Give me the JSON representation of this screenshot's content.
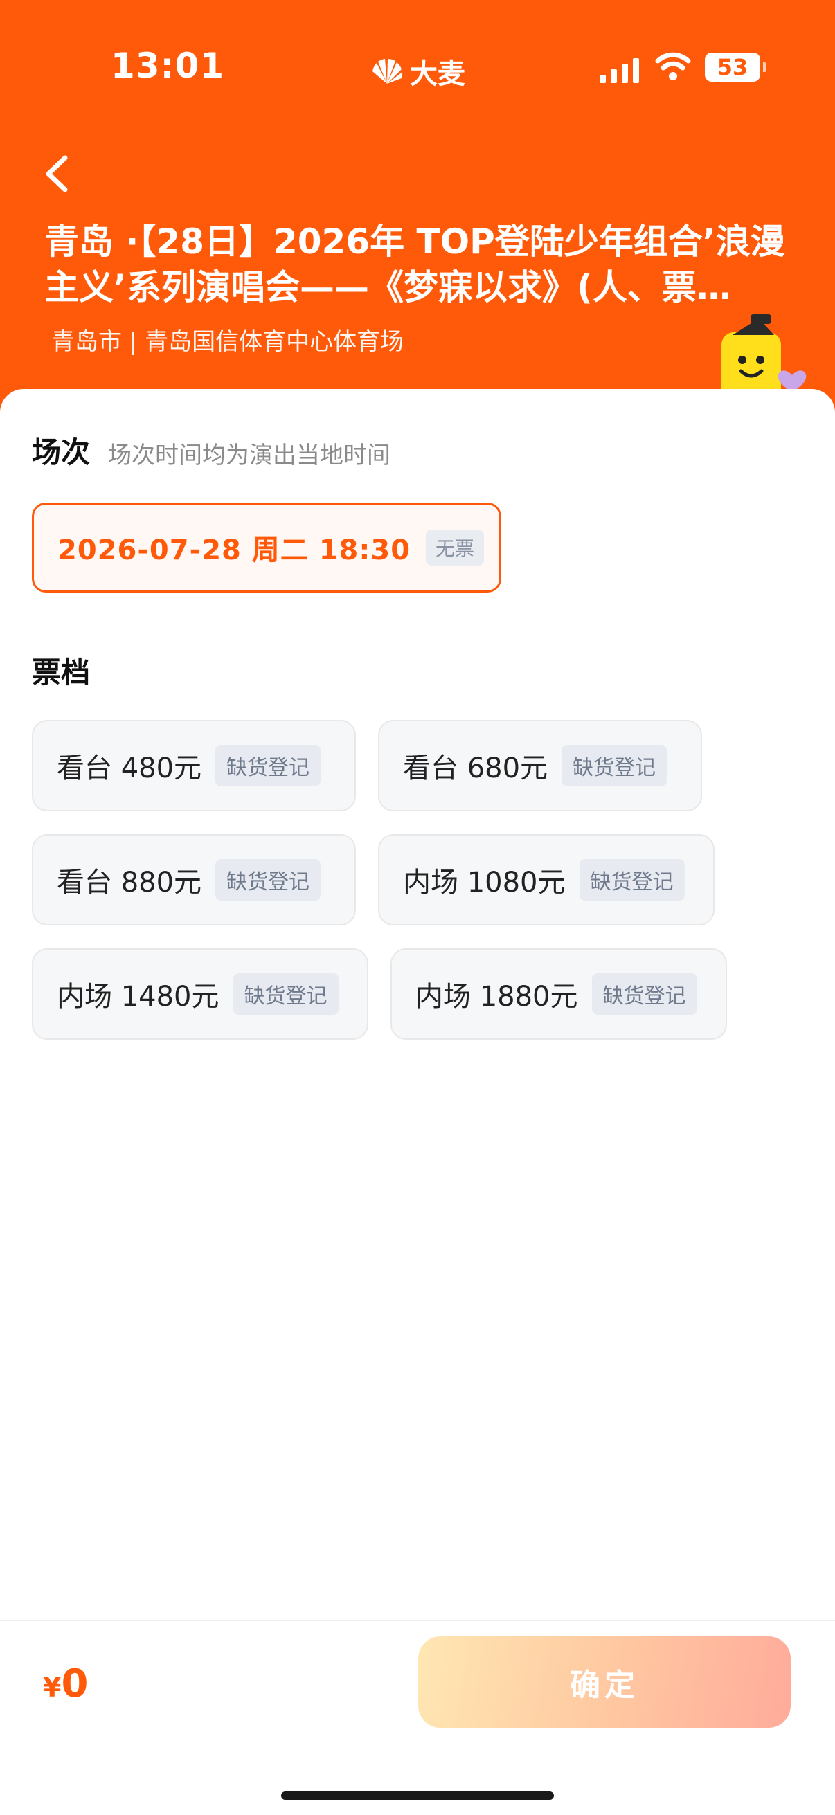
{
  "status_bar": {
    "time": "13:01",
    "brand": "大麦",
    "battery": "53",
    "icons": [
      "signal-icon",
      "wifi-icon",
      "battery-icon"
    ]
  },
  "header": {
    "title": "青岛 ·【28日】2026年 TOP登陆少年组合’浪漫主义’系列演唱会——《梦寐以求》(人、票…",
    "venue": "青岛市 | 青岛国信体育中心体育场",
    "back_icon": "chevron-left-icon",
    "accent_color": "#ff5a0a"
  },
  "session": {
    "title": "场次",
    "hint": "场次时间均为演出当地时间",
    "options": [
      {
        "label": "2026-07-28  周二 18:30",
        "badge": "无票",
        "selected": true
      }
    ]
  },
  "tiers": {
    "title": "票档",
    "items": [
      {
        "label": "看台 480元",
        "badge": "缺货登记"
      },
      {
        "label": "看台 680元",
        "badge": "缺货登记"
      },
      {
        "label": "看台 880元",
        "badge": "缺货登记"
      },
      {
        "label": "内场 1080元",
        "badge": "缺货登记"
      },
      {
        "label": "内场 1480元",
        "badge": "缺货登记"
      },
      {
        "label": "内场 1880元",
        "badge": "缺货登记"
      }
    ]
  },
  "footer": {
    "currency": "¥",
    "total": "0",
    "confirm_label": "确定"
  }
}
